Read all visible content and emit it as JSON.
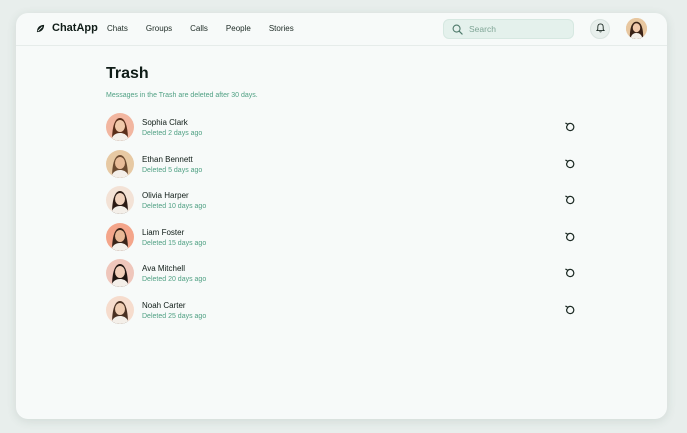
{
  "app": {
    "name": "ChatApp",
    "logo_icon": "leaf-logo-icon"
  },
  "nav": {
    "items": [
      {
        "label": "Chats"
      },
      {
        "label": "Groups"
      },
      {
        "label": "Calls"
      },
      {
        "label": "People"
      },
      {
        "label": "Stories"
      }
    ]
  },
  "search": {
    "placeholder": "Search",
    "icon": "search-icon"
  },
  "header": {
    "notifications_icon": "bell-icon"
  },
  "page": {
    "title": "Trash",
    "subtitle": "Messages in the Trash are deleted after 30 days."
  },
  "trash": {
    "items": [
      {
        "name": "Sophia Clark",
        "meta": "Deleted 2 days ago",
        "avatar_bg": "#f2b6a0",
        "hair": "#5a2e1a",
        "skin": "#f0c8aa"
      },
      {
        "name": "Ethan Bennett",
        "meta": "Deleted 5 days ago",
        "avatar_bg": "#e7c9a3",
        "hair": "#6b4a2f",
        "skin": "#e8bc98"
      },
      {
        "name": "Olivia Harper",
        "meta": "Deleted 10 days ago",
        "avatar_bg": "#f3e2d6",
        "hair": "#2b1a14",
        "skin": "#f1d2bd"
      },
      {
        "name": "Liam Foster",
        "meta": "Deleted 15 days ago",
        "avatar_bg": "#f4a58a",
        "hair": "#3a2418",
        "skin": "#e9b896"
      },
      {
        "name": "Ava Mitchell",
        "meta": "Deleted 20 days ago",
        "avatar_bg": "#efc6bb",
        "hair": "#1f1410",
        "skin": "#f0cdb8"
      },
      {
        "name": "Noah Carter",
        "meta": "Deleted 25 days ago",
        "avatar_bg": "#f6dccd",
        "hair": "#4a3022",
        "skin": "#f0cdb3"
      }
    ],
    "restore_icon": "restore-icon"
  },
  "colors": {
    "accent": "#4fa083",
    "background": "#e8eeec",
    "panel": "#f7faf9",
    "text": "#0f1c17"
  }
}
